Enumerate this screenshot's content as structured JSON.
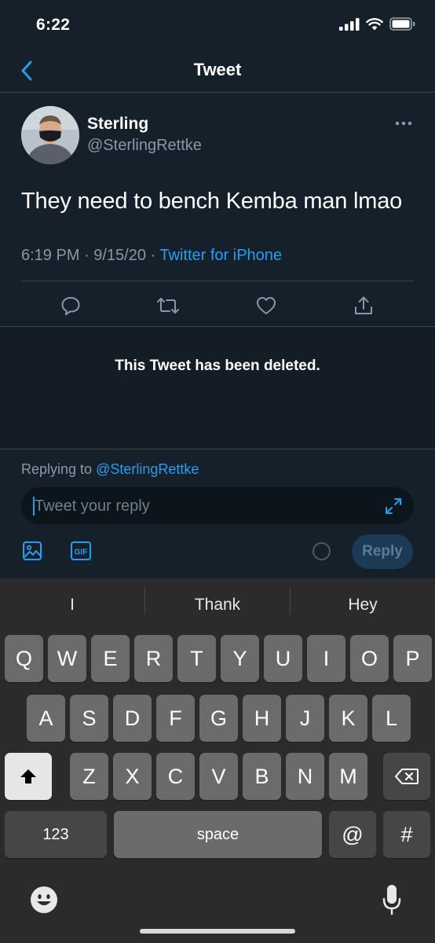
{
  "status": {
    "time": "6:22"
  },
  "nav": {
    "title": "Tweet"
  },
  "tweet": {
    "display_name": "Sterling",
    "handle": "@SterlingRettke",
    "text": "They need to bench Kemba man lmao",
    "timestamp": "6:19 PM · 9/15/20 · ",
    "source": "Twitter for iPhone"
  },
  "deleted_notice": "This Tweet has been deleted.",
  "reply": {
    "replying_prefix": "Replying to ",
    "replying_to": "@SterlingRettke",
    "placeholder": "Tweet your reply",
    "gif_label": "GIF",
    "reply_button": "Reply"
  },
  "keyboard": {
    "suggestions": [
      "I",
      "Thank",
      "Hey"
    ],
    "row1": [
      "Q",
      "W",
      "E",
      "R",
      "T",
      "Y",
      "U",
      "I",
      "O",
      "P"
    ],
    "row2": [
      "A",
      "S",
      "D",
      "F",
      "G",
      "H",
      "J",
      "K",
      "L"
    ],
    "row3": [
      "Z",
      "X",
      "C",
      "V",
      "B",
      "N",
      "M"
    ],
    "numbers_key": "123",
    "space_key": "space",
    "at_key": "@",
    "hash_key": "#"
  },
  "icons": {
    "back": "chevron-left-icon",
    "more": "ellipsis-icon",
    "reply": "comment-icon",
    "retweet": "retweet-icon",
    "like": "heart-icon",
    "share": "share-icon",
    "image": "image-icon",
    "gif": "gif-icon",
    "expand": "expand-icon",
    "shift": "shift-icon",
    "delete": "backspace-icon",
    "emoji": "emoji-icon",
    "mic": "microphone-icon"
  },
  "colors": {
    "background": "#15202b",
    "accent": "#1da1f2",
    "secondary_text": "#8899a6"
  }
}
